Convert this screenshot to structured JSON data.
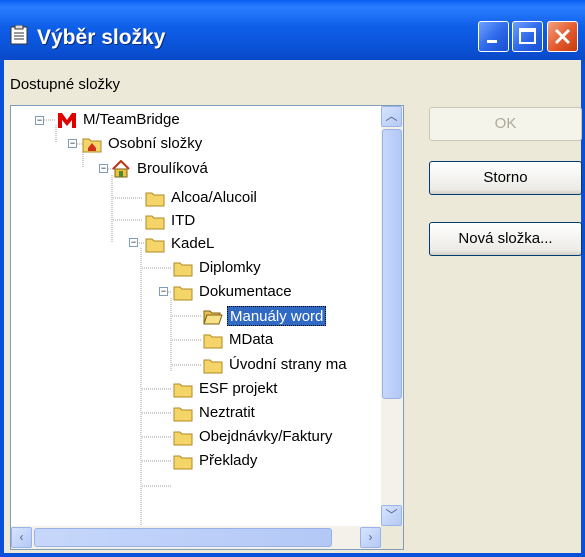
{
  "window": {
    "title": "Výběr složky"
  },
  "dialog": {
    "label": "Dostupné složky"
  },
  "buttons": {
    "ok": "OK",
    "cancel": "Storno",
    "new_folder": "Nová složka..."
  },
  "tree": {
    "items": [
      {
        "label": "M/TeamBridge",
        "icon": "teambridge-m-icon",
        "level": 0,
        "expanded": true
      },
      {
        "label": "Osobní složky",
        "icon": "personal-folder-icon",
        "level": 1,
        "expanded": true
      },
      {
        "label": "Broulíková",
        "icon": "home-icon",
        "level": 2,
        "expanded": true
      },
      {
        "label": "Alcoa/Alucoil",
        "icon": "folder-icon",
        "level": 3
      },
      {
        "label": "ITD",
        "icon": "folder-icon",
        "level": 3
      },
      {
        "label": "KadeL",
        "icon": "folder-icon",
        "level": 3,
        "expanded": true
      },
      {
        "label": "Diplomky",
        "icon": "folder-icon",
        "level": 4
      },
      {
        "label": "Dokumentace",
        "icon": "folder-icon",
        "level": 4,
        "expanded": true
      },
      {
        "label": "Manuály word",
        "icon": "open-folder-icon",
        "level": 5,
        "selected": true
      },
      {
        "label": "MData",
        "icon": "folder-icon",
        "level": 5
      },
      {
        "label": "Úvodní strany ma",
        "icon": "folder-icon",
        "level": 5
      },
      {
        "label": "ESF projekt",
        "icon": "folder-icon",
        "level": 4
      },
      {
        "label": "Neztratit",
        "icon": "folder-icon",
        "level": 4
      },
      {
        "label": "Obejdnávky/Faktury",
        "icon": "folder-icon",
        "level": 4
      },
      {
        "label": "Překlady",
        "icon": "folder-icon",
        "level": 4
      }
    ]
  },
  "colors": {
    "titlebar": "#0a5ef0",
    "selection": "#316ac5",
    "close": "#e3592c",
    "folder": "#f5d56a"
  }
}
